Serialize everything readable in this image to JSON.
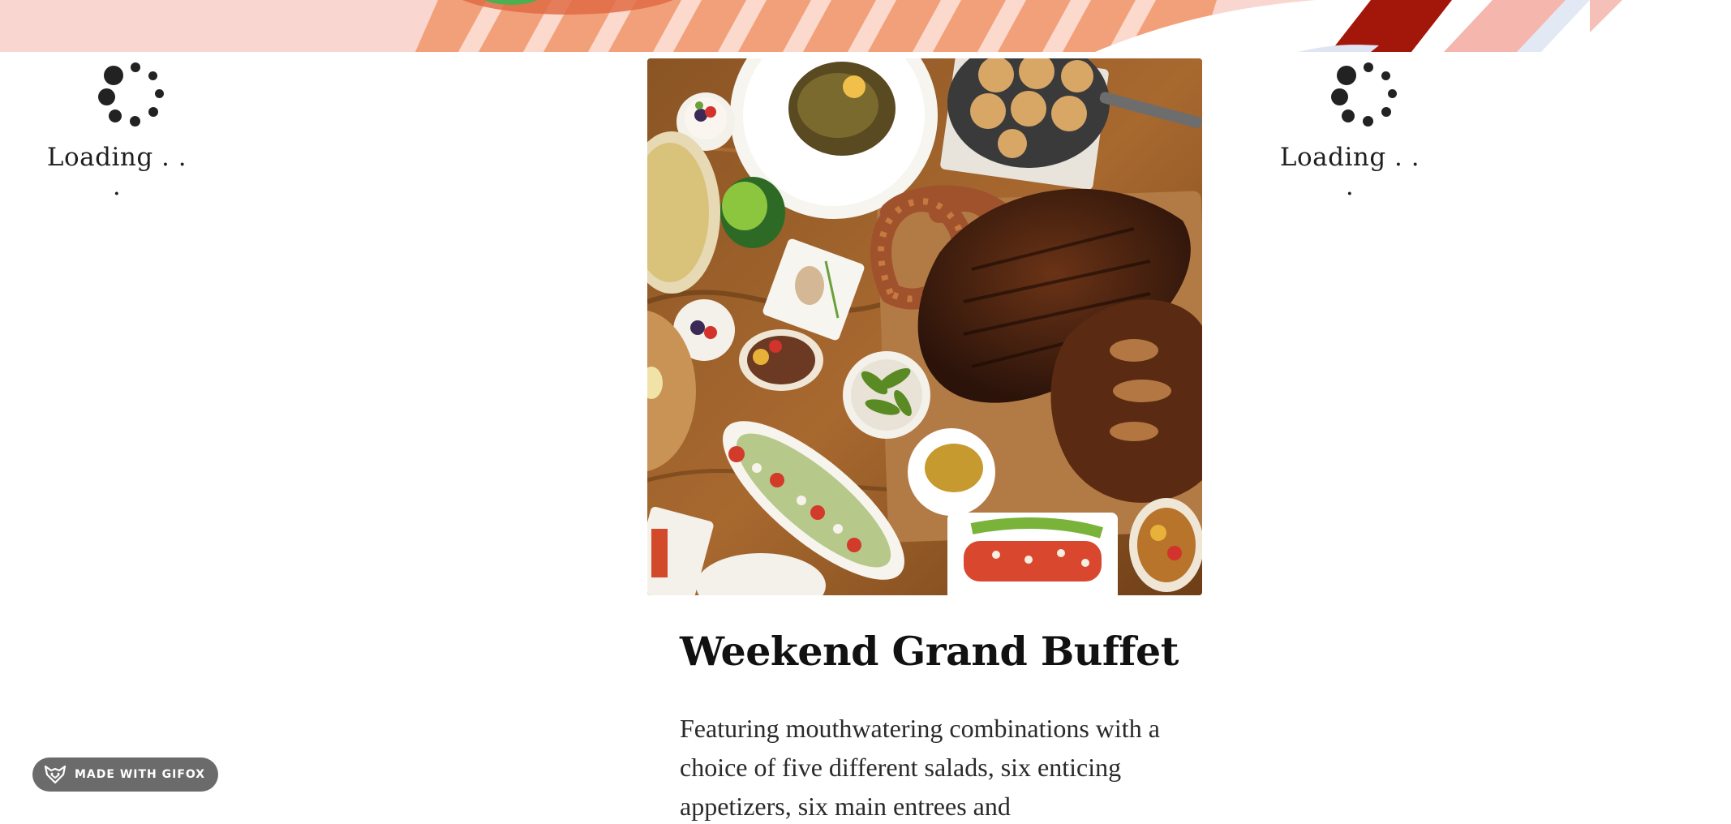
{
  "loaders": {
    "left": {
      "label": "Loading . . ."
    },
    "right": {
      "label": "Loading . . ."
    }
  },
  "card": {
    "title": "Weekend Grand Buffet",
    "description": "Featuring mouthwatering combinations with a choice of five different salads, six enticing appetizers, six main entrees and"
  },
  "badge": {
    "label": "MADE WITH GIFOX",
    "icon": "fox-icon"
  },
  "colors": {
    "banner_pink": "#f9d6cf",
    "banner_orange": "#f2a07a",
    "banner_dark_red": "#a3160a",
    "spinner": "#222222",
    "badge_bg": "#6b6b6b"
  }
}
